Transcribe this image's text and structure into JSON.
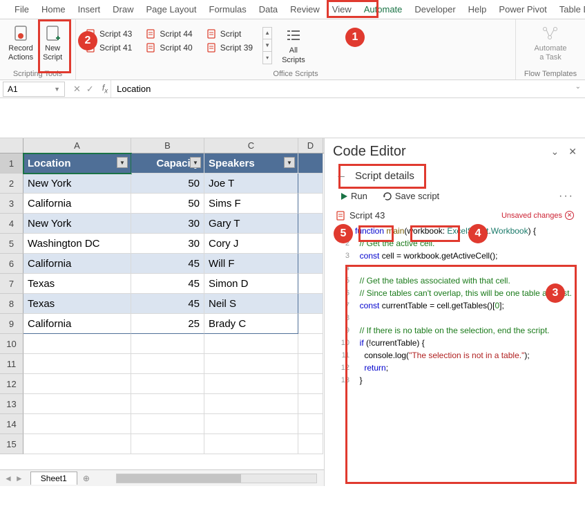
{
  "ribbon": {
    "tabs": [
      "File",
      "Home",
      "Insert",
      "Draw",
      "Page Layout",
      "Formulas",
      "Data",
      "Review",
      "View",
      "Automate",
      "Developer",
      "Help",
      "Power Pivot",
      "Table Desig"
    ],
    "active_tab": "Automate",
    "groups": {
      "scripting": {
        "label": "Scripting Tools",
        "record": "Record\nActions",
        "new_script": "New\nScript"
      },
      "office_scripts": {
        "label": "Office Scripts",
        "items": [
          "Script 43",
          "Script 41",
          "Script 44",
          "Script 40",
          "Script",
          "Script 39"
        ],
        "all_scripts": "All\nScripts"
      },
      "flow": {
        "label": "Flow Templates",
        "automate_task": "Automate\na Task"
      }
    }
  },
  "formula_bar": {
    "name_box": "A1",
    "formula": "Location"
  },
  "table": {
    "headers": [
      "Location",
      "Capacity",
      "Speakers"
    ],
    "rows": [
      {
        "loc": "New York",
        "cap": 50,
        "spk": "Joe T"
      },
      {
        "loc": "California",
        "cap": 50,
        "spk": "Sims F"
      },
      {
        "loc": "New York",
        "cap": 30,
        "spk": "Gary T"
      },
      {
        "loc": "Washington DC",
        "cap": 30,
        "spk": "Cory J"
      },
      {
        "loc": "California",
        "cap": 45,
        "spk": "Will F"
      },
      {
        "loc": "Texas",
        "cap": 45,
        "spk": "Simon D"
      },
      {
        "loc": "Texas",
        "cap": 45,
        "spk": "Neil S"
      },
      {
        "loc": "California",
        "cap": 25,
        "spk": "Brady C"
      }
    ]
  },
  "sheet": {
    "name": "Sheet1",
    "columns": [
      "A",
      "B",
      "C",
      "D"
    ]
  },
  "editor": {
    "title": "Code Editor",
    "subtitle": "Script details",
    "run": "Run",
    "save": "Save script",
    "script_name": "Script 43",
    "unsaved": "Unsaved changes"
  },
  "code_lines": [
    {
      "n": 1,
      "html": "<span class='kw'>function</span> <span class='fn'>main</span>(workbook: <span class='ty'>ExcelScript</span>.<span class='ty'>Workbook</span>) {"
    },
    {
      "n": 2,
      "html": "  <span class='cm'>// Get the active cell.</span>"
    },
    {
      "n": 3,
      "html": "  <span class='kw'>const</span> cell = workbook.getActiveCell();"
    },
    {
      "n": 4,
      "html": ""
    },
    {
      "n": 5,
      "html": "  <span class='cm'>// Get the tables associated with that cell.</span>"
    },
    {
      "n": 6,
      "html": "  <span class='cm'>// Since tables can't overlap, this will be one table at most.</span>"
    },
    {
      "n": 7,
      "html": "  <span class='kw'>const</span> currentTable = cell.getTables()[<span class='num-lit'>0</span>];"
    },
    {
      "n": 8,
      "html": ""
    },
    {
      "n": 9,
      "html": "  <span class='cm'>// If there is no table on the selection, end the script.</span>"
    },
    {
      "n": 10,
      "html": "  <span class='kw'>if</span> (!currentTable) {"
    },
    {
      "n": 11,
      "html": "    console.log(<span class='str'>\"The selection is not in a table.\"</span>);"
    },
    {
      "n": 12,
      "html": "    <span class='kw'>return</span>;"
    },
    {
      "n": 13,
      "html": "  }"
    }
  ],
  "annotations": {
    "c1": "1",
    "c2": "2",
    "c3": "3",
    "c4": "4",
    "c5": "5"
  }
}
